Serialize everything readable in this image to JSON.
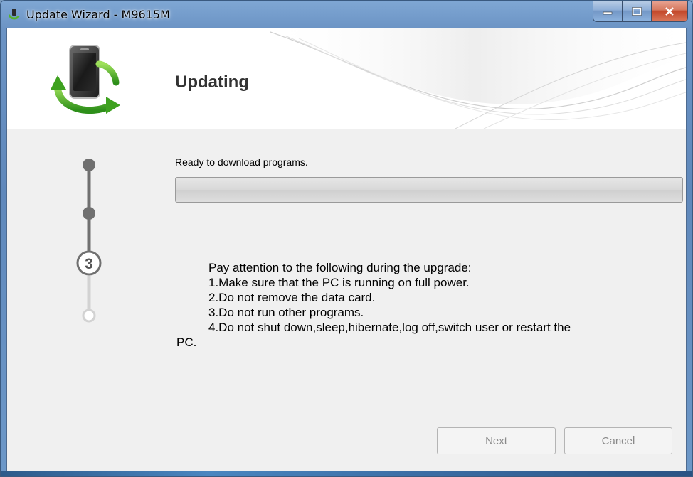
{
  "window": {
    "title": "Update Wizard - M9615M",
    "controls": {
      "minimize": "minimize",
      "maximize": "maximize",
      "close": "close"
    }
  },
  "header": {
    "title": "Updating",
    "logo_icon": "phone-sync-icon"
  },
  "steps": {
    "current_step": "3",
    "total": 4,
    "completed": 2
  },
  "status": {
    "text": "Ready to download programs.",
    "progress_percent": 0
  },
  "notes": {
    "heading": "Pay attention to the following during the upgrade:",
    "items": [
      "1.Make sure that the PC is running on full power.",
      "2.Do not remove the data card.",
      "3.Do not run other programs.",
      "4.Do not shut down,sleep,hibernate,log off,switch user or restart the"
    ],
    "wrap_tail": "PC."
  },
  "buttons": {
    "next": "Next",
    "cancel": "Cancel"
  },
  "colors": {
    "step_active": "#707070",
    "step_inactive": "#cfcfcf",
    "sync_arrows": "#5cb82e"
  }
}
